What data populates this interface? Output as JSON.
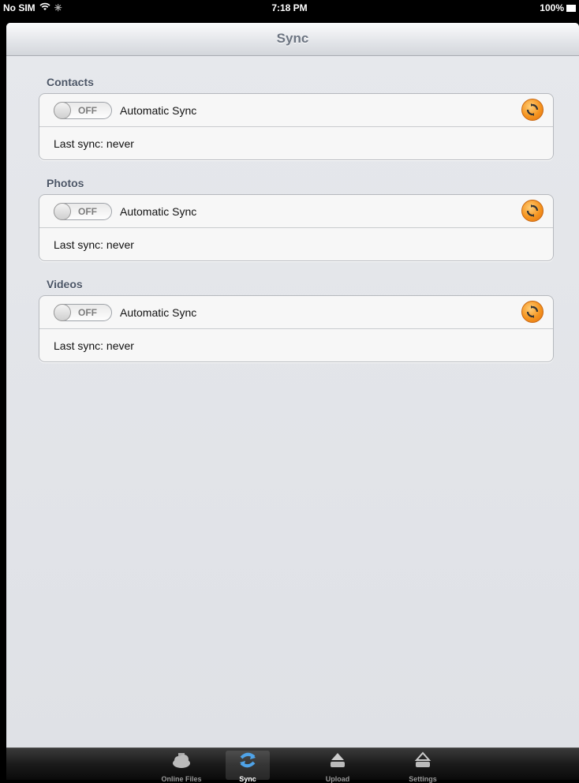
{
  "status": {
    "carrier": "No SIM",
    "time": "7:18 PM",
    "battery": "100%"
  },
  "nav": {
    "title": "Sync"
  },
  "sections": [
    {
      "title": "Contacts",
      "toggle": "OFF",
      "label": "Automatic Sync",
      "last_sync": "Last sync: never"
    },
    {
      "title": "Photos",
      "toggle": "OFF",
      "label": "Automatic Sync",
      "last_sync": "Last sync: never"
    },
    {
      "title": "Videos",
      "toggle": "OFF",
      "label": "Automatic Sync",
      "last_sync": "Last sync: never"
    }
  ],
  "tabs": [
    {
      "label": "Online Files",
      "icon": "cloud-files-icon"
    },
    {
      "label": "Sync",
      "icon": "sync-icon",
      "active": true
    },
    {
      "label": "Upload",
      "icon": "upload-icon"
    },
    {
      "label": "Settings",
      "icon": "settings-icon"
    }
  ],
  "colors": {
    "accent": "#f5941f",
    "active_tab_icon": "#4fa3e8"
  }
}
